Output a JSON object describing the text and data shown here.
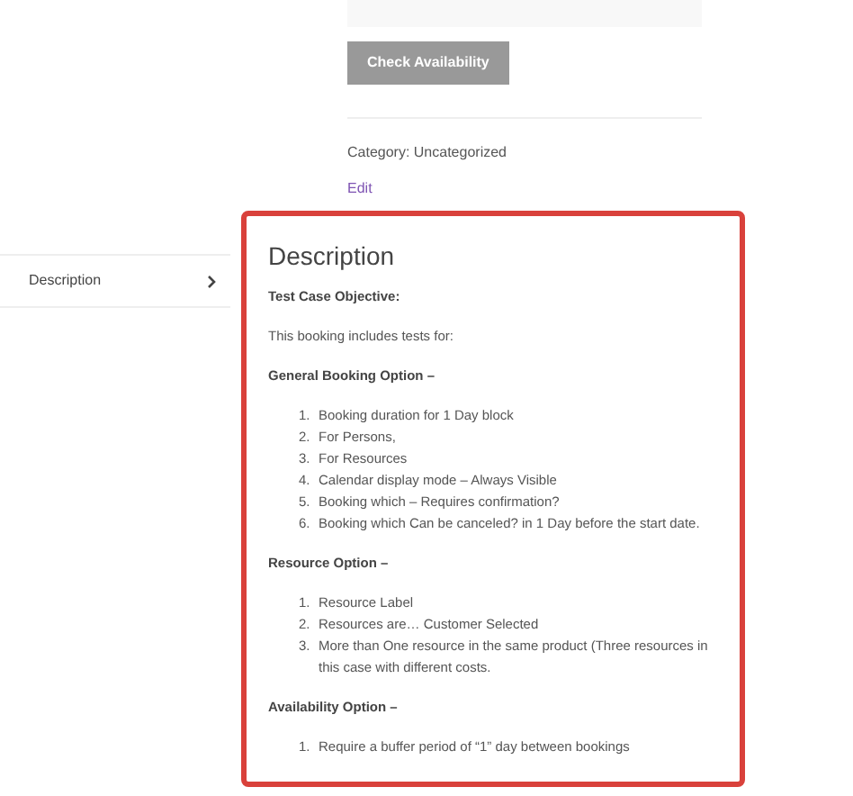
{
  "booking_form": {
    "button": "Check Availability"
  },
  "meta": {
    "category_label": "Category:",
    "category": "Uncategorized",
    "edit": "Edit"
  },
  "tabs": [
    {
      "label": "Description",
      "selected": true
    }
  ],
  "panel": {
    "title": "Description",
    "blocks": [
      {
        "kind": "heading",
        "text": "Test Case Objective:"
      },
      {
        "kind": "paragraph",
        "text": "This booking includes tests for:"
      },
      {
        "kind": "heading",
        "text": "General Booking Option –"
      },
      {
        "kind": "list",
        "items": [
          {
            "marker": "1.",
            "text": "Booking duration for 1 Day block"
          },
          {
            "marker": "2.",
            "text": "For Persons,"
          },
          {
            "marker": "3.",
            "text": "For Resources"
          },
          {
            "marker": "4.",
            "text": "Calendar display mode – Always Visible"
          },
          {
            "marker": "5.",
            "text": "Booking which  – Requires confirmation?"
          },
          {
            "marker": "6.",
            "text": "Booking which Can be canceled? in 1 Day before the start date."
          }
        ]
      },
      {
        "kind": "heading",
        "text": "Resource Option –"
      },
      {
        "kind": "list",
        "items": [
          {
            "marker": "1.",
            "text": "Resource Label"
          },
          {
            "marker": "2.",
            "text": "Resources are… Customer Selected"
          },
          {
            "marker": "3.",
            "text": "More than One resource in the same product (Three resources in this case with different costs."
          }
        ]
      },
      {
        "kind": "heading",
        "text": "Availability Option –"
      },
      {
        "kind": "list",
        "items": [
          {
            "marker": "1.",
            "text": "Require a buffer period of “1” day between bookings"
          }
        ]
      }
    ]
  }
}
